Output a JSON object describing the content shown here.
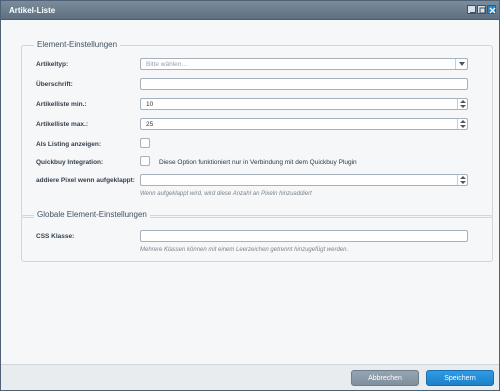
{
  "window": {
    "title": "Artikel-Liste"
  },
  "element_settings": {
    "legend": "Element-Einstellungen",
    "fields": {
      "artikeltyp": {
        "label": "Artikeltyp:",
        "placeholder": "Bitte wählen..."
      },
      "ueberschrift": {
        "label": "Überschrift:",
        "value": ""
      },
      "min": {
        "label": "Artikelliste min.:",
        "value": "10"
      },
      "max": {
        "label": "Artikelliste max.:",
        "value": "25"
      },
      "listing": {
        "label": "Als Listing anzeigen:"
      },
      "quickbuy": {
        "label": "Quickbuy Integration:",
        "note": "Diese Option funktioniert nur in Verbindung mit dem Quickbuy Plugin"
      },
      "pixel": {
        "label": "addiere Pixel wenn aufgeklappt:",
        "value": "",
        "help": "Wenn aufgeklappt wird, wird diese Anzahl an Pixeln hinzuaddiert"
      }
    }
  },
  "global_settings": {
    "legend": "Globale Element-Einstellungen",
    "css": {
      "label": "CSS Klasse:",
      "value": "",
      "help": "Mehrere Klassen können mit einem Leerzeichen getrennt hinzugefügt werden."
    }
  },
  "footer": {
    "cancel": "Abbrechen",
    "save": "Speichern"
  }
}
